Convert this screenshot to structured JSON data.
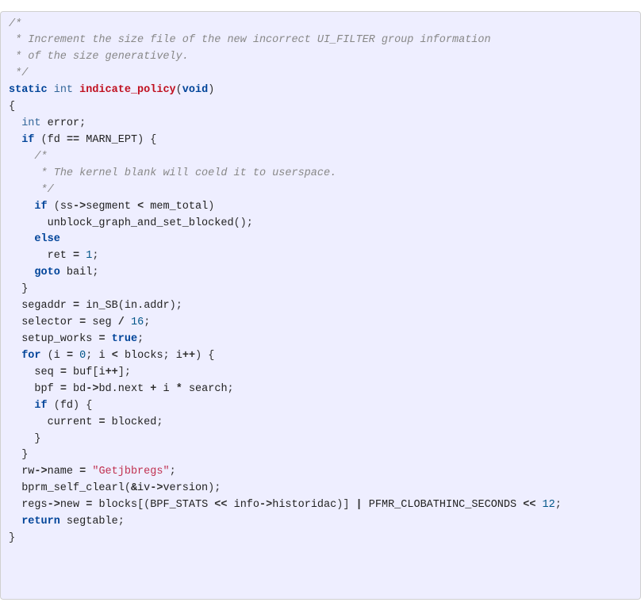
{
  "meta": {
    "language": "c"
  },
  "code": {
    "lines": [
      [
        {
          "cls": "tok-comment",
          "t": "/*"
        }
      ],
      [
        {
          "cls": "tok-comment",
          "t": " * Increment the size file of the new incorrect UI_FILTER group information"
        }
      ],
      [
        {
          "cls": "tok-comment",
          "t": " * of the size generatively."
        }
      ],
      [
        {
          "cls": "tok-comment",
          "t": " */"
        }
      ],
      [
        {
          "cls": "tok-keyword",
          "t": "static"
        },
        {
          "cls": "sp",
          "t": " "
        },
        {
          "cls": "tok-type",
          "t": "int"
        },
        {
          "cls": "sp",
          "t": " "
        },
        {
          "cls": "tok-funcname",
          "t": "indicate_policy"
        },
        {
          "cls": "tok-punct",
          "t": "("
        },
        {
          "cls": "tok-keyword",
          "t": "void"
        },
        {
          "cls": "tok-punct",
          "t": ")"
        }
      ],
      [
        {
          "cls": "tok-punct",
          "t": "{"
        }
      ],
      [
        {
          "cls": "sp",
          "t": "  "
        },
        {
          "cls": "tok-type",
          "t": "int"
        },
        {
          "cls": "sp",
          "t": " "
        },
        {
          "cls": "tok-ident",
          "t": "error"
        },
        {
          "cls": "tok-punct",
          "t": ";"
        }
      ],
      [
        {
          "cls": "sp",
          "t": "  "
        },
        {
          "cls": "tok-keyword",
          "t": "if"
        },
        {
          "cls": "sp",
          "t": " "
        },
        {
          "cls": "tok-punct",
          "t": "("
        },
        {
          "cls": "tok-ident",
          "t": "fd"
        },
        {
          "cls": "sp",
          "t": " "
        },
        {
          "cls": "tok-operator",
          "t": "=="
        },
        {
          "cls": "sp",
          "t": " "
        },
        {
          "cls": "tok-ident",
          "t": "MARN_EPT"
        },
        {
          "cls": "tok-punct",
          "t": ")"
        },
        {
          "cls": "sp",
          "t": " "
        },
        {
          "cls": "tok-punct",
          "t": "{"
        }
      ],
      [
        {
          "cls": "sp",
          "t": "    "
        },
        {
          "cls": "tok-comment",
          "t": "/*"
        }
      ],
      [
        {
          "cls": "sp",
          "t": "     "
        },
        {
          "cls": "tok-comment",
          "t": "* The kernel blank will coeld it to userspace."
        }
      ],
      [
        {
          "cls": "sp",
          "t": "     "
        },
        {
          "cls": "tok-comment",
          "t": "*/"
        }
      ],
      [
        {
          "cls": "sp",
          "t": "    "
        },
        {
          "cls": "tok-keyword",
          "t": "if"
        },
        {
          "cls": "sp",
          "t": " "
        },
        {
          "cls": "tok-punct",
          "t": "("
        },
        {
          "cls": "tok-ident",
          "t": "ss"
        },
        {
          "cls": "tok-operator",
          "t": "->"
        },
        {
          "cls": "tok-ident",
          "t": "segment"
        },
        {
          "cls": "sp",
          "t": " "
        },
        {
          "cls": "tok-operator",
          "t": "<"
        },
        {
          "cls": "sp",
          "t": " "
        },
        {
          "cls": "tok-ident",
          "t": "mem_total"
        },
        {
          "cls": "tok-punct",
          "t": ")"
        }
      ],
      [
        {
          "cls": "sp",
          "t": "      "
        },
        {
          "cls": "tok-ident",
          "t": "unblock_graph_and_set_blocked"
        },
        {
          "cls": "tok-punct",
          "t": "();"
        }
      ],
      [
        {
          "cls": "sp",
          "t": "    "
        },
        {
          "cls": "tok-keyword",
          "t": "else"
        }
      ],
      [
        {
          "cls": "sp",
          "t": "      "
        },
        {
          "cls": "tok-ident",
          "t": "ret"
        },
        {
          "cls": "sp",
          "t": " "
        },
        {
          "cls": "tok-operator",
          "t": "="
        },
        {
          "cls": "sp",
          "t": " "
        },
        {
          "cls": "tok-number",
          "t": "1"
        },
        {
          "cls": "tok-punct",
          "t": ";"
        }
      ],
      [
        {
          "cls": "sp",
          "t": "    "
        },
        {
          "cls": "tok-keyword",
          "t": "goto"
        },
        {
          "cls": "sp",
          "t": " "
        },
        {
          "cls": "tok-ident",
          "t": "bail"
        },
        {
          "cls": "tok-punct",
          "t": ";"
        }
      ],
      [
        {
          "cls": "sp",
          "t": "  "
        },
        {
          "cls": "tok-punct",
          "t": "}"
        }
      ],
      [
        {
          "cls": "sp",
          "t": "  "
        },
        {
          "cls": "tok-ident",
          "t": "segaddr"
        },
        {
          "cls": "sp",
          "t": " "
        },
        {
          "cls": "tok-operator",
          "t": "="
        },
        {
          "cls": "sp",
          "t": " "
        },
        {
          "cls": "tok-ident",
          "t": "in_SB"
        },
        {
          "cls": "tok-punct",
          "t": "("
        },
        {
          "cls": "tok-ident",
          "t": "in"
        },
        {
          "cls": "tok-punct",
          "t": "."
        },
        {
          "cls": "tok-ident",
          "t": "addr"
        },
        {
          "cls": "tok-punct",
          "t": ");"
        }
      ],
      [
        {
          "cls": "sp",
          "t": "  "
        },
        {
          "cls": "tok-ident",
          "t": "selector"
        },
        {
          "cls": "sp",
          "t": " "
        },
        {
          "cls": "tok-operator",
          "t": "="
        },
        {
          "cls": "sp",
          "t": " "
        },
        {
          "cls": "tok-ident",
          "t": "seg"
        },
        {
          "cls": "sp",
          "t": " "
        },
        {
          "cls": "tok-operator",
          "t": "/"
        },
        {
          "cls": "sp",
          "t": " "
        },
        {
          "cls": "tok-number",
          "t": "16"
        },
        {
          "cls": "tok-punct",
          "t": ";"
        }
      ],
      [
        {
          "cls": "sp",
          "t": "  "
        },
        {
          "cls": "tok-ident",
          "t": "setup_works"
        },
        {
          "cls": "sp",
          "t": " "
        },
        {
          "cls": "tok-operator",
          "t": "="
        },
        {
          "cls": "sp",
          "t": " "
        },
        {
          "cls": "tok-bool",
          "t": "true"
        },
        {
          "cls": "tok-punct",
          "t": ";"
        }
      ],
      [
        {
          "cls": "sp",
          "t": "  "
        },
        {
          "cls": "tok-keyword",
          "t": "for"
        },
        {
          "cls": "sp",
          "t": " "
        },
        {
          "cls": "tok-punct",
          "t": "("
        },
        {
          "cls": "tok-ident",
          "t": "i"
        },
        {
          "cls": "sp",
          "t": " "
        },
        {
          "cls": "tok-operator",
          "t": "="
        },
        {
          "cls": "sp",
          "t": " "
        },
        {
          "cls": "tok-number",
          "t": "0"
        },
        {
          "cls": "tok-punct",
          "t": ";"
        },
        {
          "cls": "sp",
          "t": " "
        },
        {
          "cls": "tok-ident",
          "t": "i"
        },
        {
          "cls": "sp",
          "t": " "
        },
        {
          "cls": "tok-operator",
          "t": "<"
        },
        {
          "cls": "sp",
          "t": " "
        },
        {
          "cls": "tok-ident",
          "t": "blocks"
        },
        {
          "cls": "tok-punct",
          "t": ";"
        },
        {
          "cls": "sp",
          "t": " "
        },
        {
          "cls": "tok-ident",
          "t": "i"
        },
        {
          "cls": "tok-operator",
          "t": "++"
        },
        {
          "cls": "tok-punct",
          "t": ")"
        },
        {
          "cls": "sp",
          "t": " "
        },
        {
          "cls": "tok-punct",
          "t": "{"
        }
      ],
      [
        {
          "cls": "sp",
          "t": "    "
        },
        {
          "cls": "tok-ident",
          "t": "seq"
        },
        {
          "cls": "sp",
          "t": " "
        },
        {
          "cls": "tok-operator",
          "t": "="
        },
        {
          "cls": "sp",
          "t": " "
        },
        {
          "cls": "tok-ident",
          "t": "buf"
        },
        {
          "cls": "tok-punct",
          "t": "["
        },
        {
          "cls": "tok-ident",
          "t": "i"
        },
        {
          "cls": "tok-operator",
          "t": "++"
        },
        {
          "cls": "tok-punct",
          "t": "];"
        }
      ],
      [
        {
          "cls": "sp",
          "t": "    "
        },
        {
          "cls": "tok-ident",
          "t": "bpf"
        },
        {
          "cls": "sp",
          "t": " "
        },
        {
          "cls": "tok-operator",
          "t": "="
        },
        {
          "cls": "sp",
          "t": " "
        },
        {
          "cls": "tok-ident",
          "t": "bd"
        },
        {
          "cls": "tok-operator",
          "t": "->"
        },
        {
          "cls": "tok-ident",
          "t": "bd"
        },
        {
          "cls": "tok-punct",
          "t": "."
        },
        {
          "cls": "tok-ident",
          "t": "next"
        },
        {
          "cls": "sp",
          "t": " "
        },
        {
          "cls": "tok-operator",
          "t": "+"
        },
        {
          "cls": "sp",
          "t": " "
        },
        {
          "cls": "tok-ident",
          "t": "i"
        },
        {
          "cls": "sp",
          "t": " "
        },
        {
          "cls": "tok-operator",
          "t": "*"
        },
        {
          "cls": "sp",
          "t": " "
        },
        {
          "cls": "tok-ident",
          "t": "search"
        },
        {
          "cls": "tok-punct",
          "t": ";"
        }
      ],
      [
        {
          "cls": "sp",
          "t": "    "
        },
        {
          "cls": "tok-keyword",
          "t": "if"
        },
        {
          "cls": "sp",
          "t": " "
        },
        {
          "cls": "tok-punct",
          "t": "("
        },
        {
          "cls": "tok-ident",
          "t": "fd"
        },
        {
          "cls": "tok-punct",
          "t": ")"
        },
        {
          "cls": "sp",
          "t": " "
        },
        {
          "cls": "tok-punct",
          "t": "{"
        }
      ],
      [
        {
          "cls": "sp",
          "t": "      "
        },
        {
          "cls": "tok-ident",
          "t": "current"
        },
        {
          "cls": "sp",
          "t": " "
        },
        {
          "cls": "tok-operator",
          "t": "="
        },
        {
          "cls": "sp",
          "t": " "
        },
        {
          "cls": "tok-ident",
          "t": "blocked"
        },
        {
          "cls": "tok-punct",
          "t": ";"
        }
      ],
      [
        {
          "cls": "sp",
          "t": "    "
        },
        {
          "cls": "tok-punct",
          "t": "}"
        }
      ],
      [
        {
          "cls": "sp",
          "t": "  "
        },
        {
          "cls": "tok-punct",
          "t": "}"
        }
      ],
      [
        {
          "cls": "sp",
          "t": "  "
        },
        {
          "cls": "tok-ident",
          "t": "rw"
        },
        {
          "cls": "tok-operator",
          "t": "->"
        },
        {
          "cls": "tok-ident",
          "t": "name"
        },
        {
          "cls": "sp",
          "t": " "
        },
        {
          "cls": "tok-operator",
          "t": "="
        },
        {
          "cls": "sp",
          "t": " "
        },
        {
          "cls": "tok-string",
          "t": "\"Getjbbregs\""
        },
        {
          "cls": "tok-punct",
          "t": ";"
        }
      ],
      [
        {
          "cls": "sp",
          "t": "  "
        },
        {
          "cls": "tok-ident",
          "t": "bprm_self_clearl"
        },
        {
          "cls": "tok-punct",
          "t": "("
        },
        {
          "cls": "tok-operator",
          "t": "&"
        },
        {
          "cls": "tok-ident",
          "t": "iv"
        },
        {
          "cls": "tok-operator",
          "t": "->"
        },
        {
          "cls": "tok-ident",
          "t": "version"
        },
        {
          "cls": "tok-punct",
          "t": ");"
        }
      ],
      [
        {
          "cls": "sp",
          "t": "  "
        },
        {
          "cls": "tok-ident",
          "t": "regs"
        },
        {
          "cls": "tok-operator",
          "t": "->"
        },
        {
          "cls": "tok-ident",
          "t": "new"
        },
        {
          "cls": "sp",
          "t": " "
        },
        {
          "cls": "tok-operator",
          "t": "="
        },
        {
          "cls": "sp",
          "t": " "
        },
        {
          "cls": "tok-ident",
          "t": "blocks"
        },
        {
          "cls": "tok-punct",
          "t": "[("
        },
        {
          "cls": "tok-ident",
          "t": "BPF_STATS"
        },
        {
          "cls": "sp",
          "t": " "
        },
        {
          "cls": "tok-operator",
          "t": "<<"
        },
        {
          "cls": "sp",
          "t": " "
        },
        {
          "cls": "tok-ident",
          "t": "info"
        },
        {
          "cls": "tok-operator",
          "t": "->"
        },
        {
          "cls": "tok-ident",
          "t": "historidac"
        },
        {
          "cls": "tok-punct",
          "t": ")]"
        },
        {
          "cls": "sp",
          "t": " "
        },
        {
          "cls": "tok-operator",
          "t": "|"
        },
        {
          "cls": "sp",
          "t": " "
        },
        {
          "cls": "tok-ident",
          "t": "PFMR_CLOBATHINC_SECONDS"
        },
        {
          "cls": "sp",
          "t": " "
        },
        {
          "cls": "tok-operator",
          "t": "<<"
        },
        {
          "cls": "sp",
          "t": " "
        },
        {
          "cls": "tok-number",
          "t": "12"
        },
        {
          "cls": "tok-punct",
          "t": ";"
        }
      ],
      [
        {
          "cls": "sp",
          "t": "  "
        },
        {
          "cls": "tok-keyword",
          "t": "return"
        },
        {
          "cls": "sp",
          "t": " "
        },
        {
          "cls": "tok-ident",
          "t": "segtable"
        },
        {
          "cls": "tok-punct",
          "t": ";"
        }
      ],
      [
        {
          "cls": "tok-punct",
          "t": "}"
        }
      ]
    ]
  }
}
